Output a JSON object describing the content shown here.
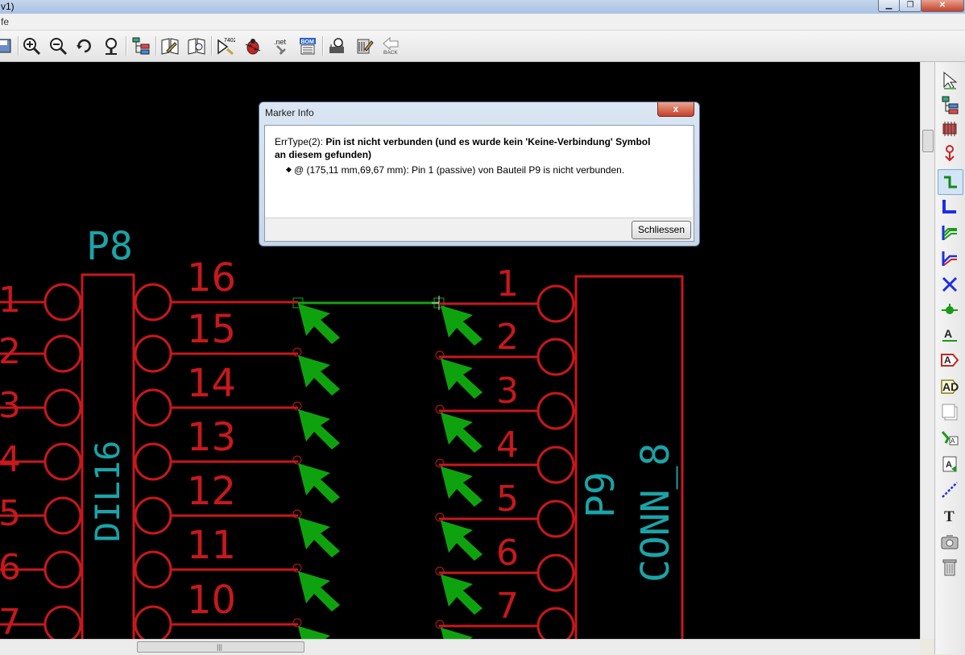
{
  "window": {
    "title": "v1)",
    "menu_fragment": "fe"
  },
  "toolbar": {
    "icons": [
      "save-icon",
      "zoom-in-icon",
      "zoom-out-icon",
      "redraw-icon",
      "zoom-fit-icon",
      "hierarchy-icon",
      "library-editor-icon",
      "library-browser-icon",
      "annotate-icon",
      "erc-icon",
      "netlist-icon",
      "bom-icon",
      "cvpcb-icon",
      "pcbnew-icon",
      "back-icon"
    ],
    "annotate_label": "7402",
    "netlist_label": ".net",
    "bom_label": "BOM",
    "back_label": "BACK"
  },
  "dialog": {
    "title": "Marker Info",
    "close_glyph": "x",
    "err_prefix": "ErrType(2): ",
    "err_message": "Pin ist nicht verbunden (und es wurde kein 'Keine-Verbindung' Symbol an diesem gefunden)",
    "bullet": "◆",
    "detail": "@ (175,11 mm,69,67 mm): Pin 1 (passive) von Bauteil P9 is nicht verbunden.",
    "close_button": "Schliessen"
  },
  "schematic": {
    "left_component": {
      "reference": "P8",
      "value": "DIL16",
      "left_pin_numbers": [
        "1",
        "2",
        "3",
        "4",
        "5",
        "6",
        "7"
      ],
      "right_pin_numbers": [
        "16",
        "15",
        "14",
        "13",
        "12",
        "11",
        "10"
      ]
    },
    "right_component": {
      "reference": "P9",
      "value": "CONN_8",
      "pin_numbers": [
        "1",
        "2",
        "3",
        "4",
        "5",
        "6",
        "7"
      ]
    },
    "colors": {
      "background": "#000000",
      "component": "#c8181c",
      "text_cyan": "#1aa4a8",
      "wire": "#17a117",
      "marker": "#0ea30e"
    }
  },
  "right_toolbar": {
    "icons": [
      "select-icon",
      "hierarchy-navigator-icon",
      "place-component-icon",
      "place-power-icon",
      "wire-icon",
      "bus-icon",
      "wire-bus-entry-icon",
      "bus-bus-entry-icon",
      "no-connect-icon",
      "junction-icon",
      "net-label-icon",
      "global-label-icon",
      "hierarchical-label-icon",
      "hierarchical-sheet-icon",
      "import-sheet-pin-icon",
      "sheet-pin-icon",
      "graphic-line-icon",
      "text-icon",
      "image-icon",
      "delete-icon"
    ],
    "active_index": 4
  },
  "scrollbars": {
    "horizontal_grip": "|||"
  }
}
